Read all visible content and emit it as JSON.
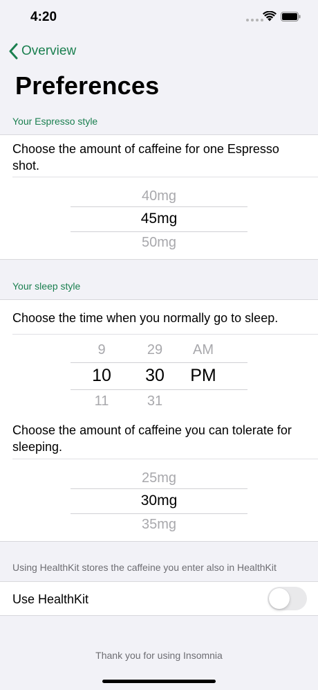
{
  "status_bar": {
    "time": "4:20"
  },
  "nav": {
    "back_label": "Overview"
  },
  "title": "Preferences",
  "espresso_section": {
    "header": "Your Espresso style",
    "description": "Choose the amount of caffeine for one Espresso shot.",
    "picker": {
      "above": "40mg",
      "selected": "45mg",
      "below": "50mg"
    }
  },
  "sleep_section": {
    "header": "Your sleep style",
    "time_description": "Choose the time when you normally go to sleep.",
    "time_picker": {
      "hours": {
        "above": "9",
        "selected": "10",
        "below": "11"
      },
      "minutes": {
        "above": "29",
        "selected": "30",
        "below": "31"
      },
      "period": {
        "above": "AM",
        "selected": "PM"
      }
    },
    "tolerance_description": "Choose the amount of caffeine you can tolerate for sleeping.",
    "tolerance_picker": {
      "above": "25mg",
      "selected": "30mg",
      "below": "35mg"
    }
  },
  "healthkit": {
    "note": "Using HealthKit stores the caffeine you enter also in HealthKit",
    "label": "Use HealthKit",
    "enabled": false
  },
  "footer": {
    "thanks": "Thank you for using Insomnia"
  },
  "colors": {
    "accent": "#1a7f4f",
    "background": "#f2f2f7"
  }
}
